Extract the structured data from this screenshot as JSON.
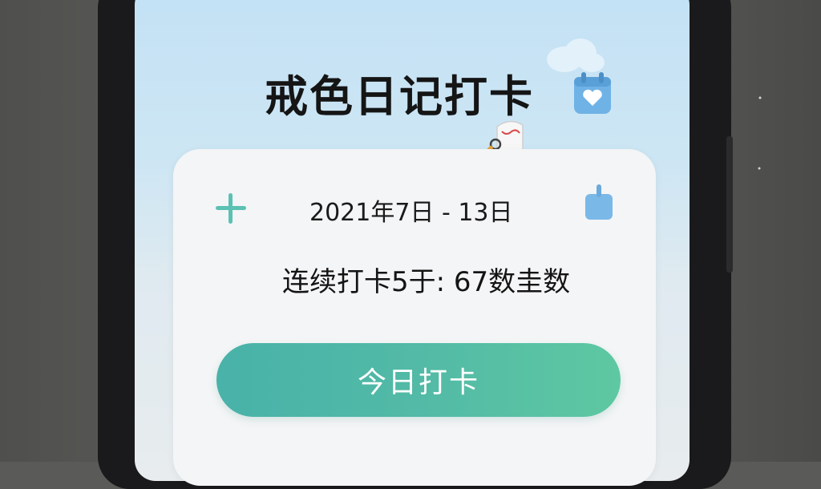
{
  "app": {
    "title": "戒色日记打卡"
  },
  "card": {
    "date_range": "2021年7日 - 13日",
    "streak_text": "连续打卡5于: 67数圭数"
  },
  "actions": {
    "checkin_label": "今日打卡"
  },
  "colors": {
    "accent_teal": "#52baa6",
    "icon_blue": "#7ab8e8",
    "plus_teal": "#5bc1b3",
    "title_text": "#151515"
  },
  "icons": {
    "add": "plus-icon",
    "calendar": "calendar-heart-icon",
    "bag": "bag-icon",
    "mascot": "magnifier-mascot-icon",
    "cloud": "cloud-icon"
  }
}
